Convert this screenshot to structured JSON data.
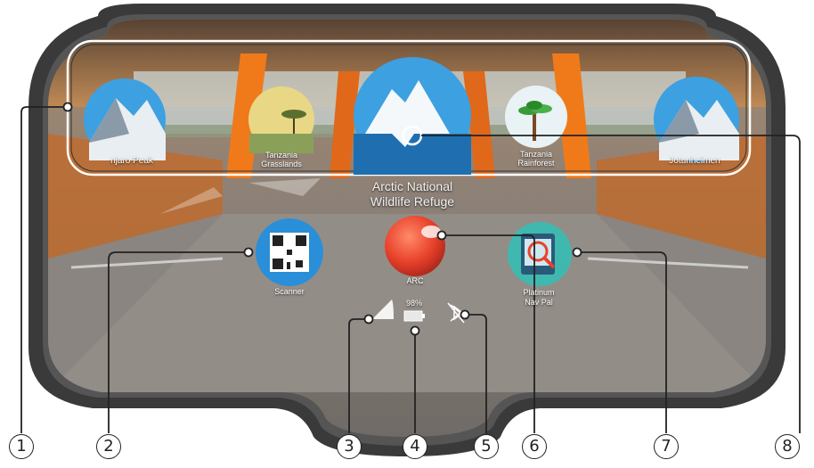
{
  "carousel": {
    "items": [
      {
        "label": "Kilimanjaro Peak",
        "icon": "mountain-icon"
      },
      {
        "label": "Tanzania Grasslands",
        "icon": "savanna-icon"
      },
      {
        "label": "Arctic National Wildlife Refuge",
        "icon": "iceberg-icon"
      },
      {
        "label": "Tanzania Rainforest",
        "icon": "palm-tree-icon"
      },
      {
        "label": "Jotunheimen",
        "icon": "mountain-icon"
      }
    ],
    "visible_labels": {
      "left_partial": "njaro Peak",
      "grasslands_line1": "Tanzania",
      "grasslands_line2": "Grasslands",
      "selected_line1": "Arctic National",
      "selected_line2": "Wildlife Refuge",
      "rainforest_line1": "Tanzania",
      "rainforest_line2": "Rainforest",
      "right_partial": "Jotunheimen"
    }
  },
  "apps": {
    "scanner": {
      "label": "Scanner",
      "icon": "qr-code-icon"
    },
    "arc": {
      "label": "ARC",
      "icon": "orb-icon"
    },
    "platinum": {
      "label_line1": "Platinum",
      "label_line2": "Nav Pal",
      "icon": "magnifier-icon"
    }
  },
  "status": {
    "wifi_icon": "wifi-icon",
    "battery_percent": "98%",
    "battery_icon": "battery-icon",
    "bluetooth_icon": "bluetooth-off-icon"
  },
  "callouts": [
    "1",
    "2",
    "3",
    "4",
    "5",
    "6",
    "7",
    "8"
  ],
  "colors": {
    "headset_frame": "#3a3a3a",
    "accent_orange": "#f07a1a",
    "sky_blue": "#3da0e0",
    "scanner_blue": "#2a8fd8",
    "arc_red": "#e8412a",
    "platinum_teal": "#3fb8b0"
  }
}
